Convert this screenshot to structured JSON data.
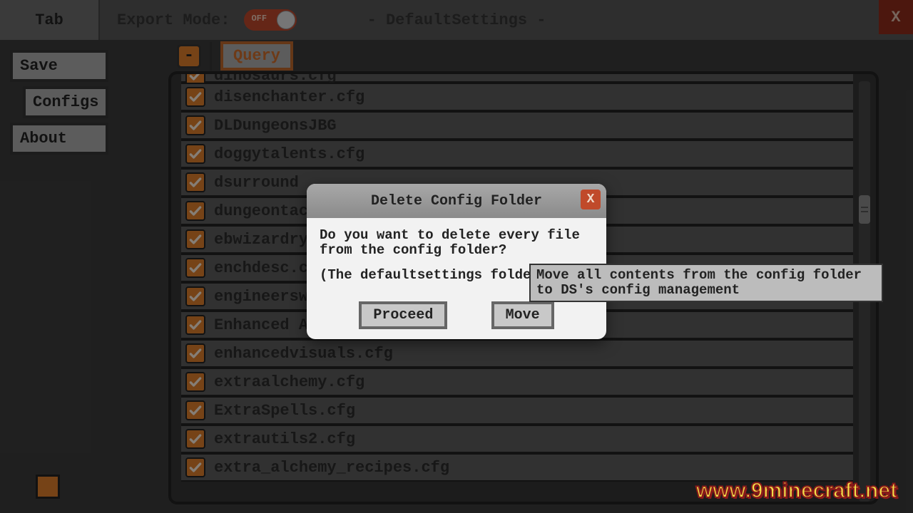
{
  "topbar": {
    "tab": "Tab",
    "export_label": "Export Mode:",
    "toggle_text": "OFF",
    "title": "- DefaultSettings -",
    "close": "X"
  },
  "sidebar": {
    "save": "Save",
    "configs": "Configs",
    "about": "About"
  },
  "actions": {
    "minus": "-",
    "query": "Query"
  },
  "list": {
    "items": [
      "dinosaurs.cfg",
      "disenchanter.cfg",
      "DLDungeonsJBG",
      "doggytalents.cfg",
      "dsurround",
      "dungeontactic",
      "ebwizardry.cf",
      "enchdesc.cfg",
      "engineerswor",
      "Enhanced Armaments",
      "enhancedvisuals.cfg",
      "extraalchemy.cfg",
      "ExtraSpells.cfg",
      "extrautils2.cfg",
      "extra_alchemy_recipes.cfg"
    ]
  },
  "dialog": {
    "title": "Delete Config Folder",
    "close": "X",
    "body1": "Do you want to delete every file from the config folder?",
    "body2": "(The defaultsettings folder wi",
    "proceed": "Proceed",
    "move": "Move"
  },
  "tooltip": {
    "text": "Move all contents from the config folder to DS's config management"
  },
  "watermark": "www.9minecraft.net"
}
